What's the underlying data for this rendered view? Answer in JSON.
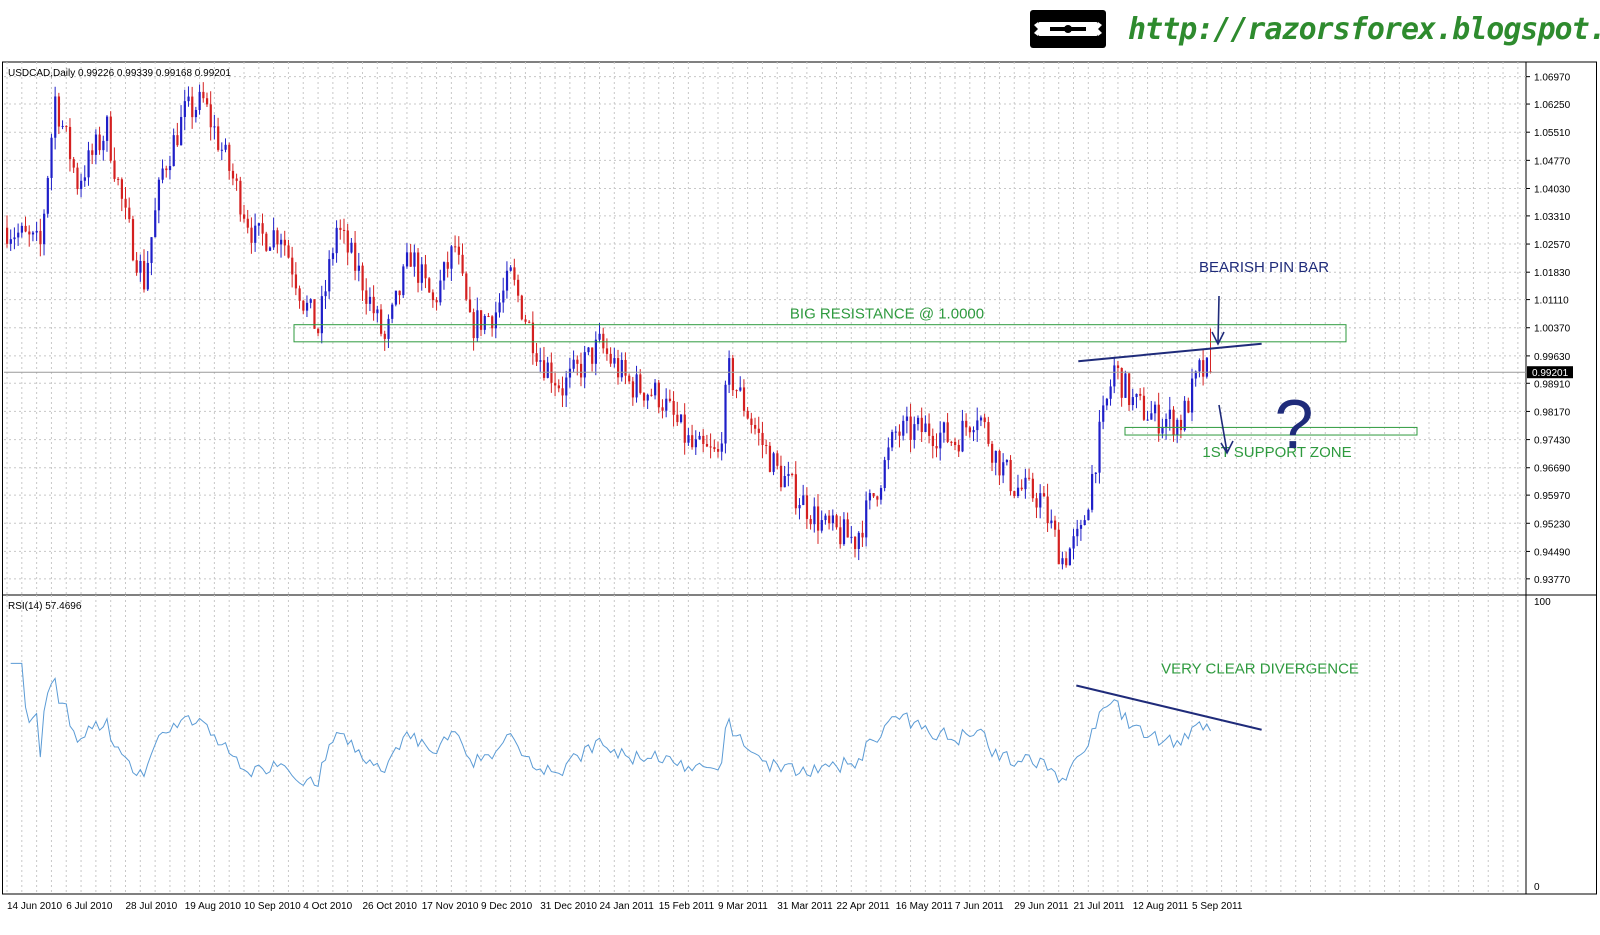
{
  "header": {
    "url": "http://razorsforex.blogspot.com",
    "logo_icon": "razor-blade-icon"
  },
  "colors": {
    "bull_candle": "#1f1fc8",
    "bear_candle": "#d42020",
    "grid": "#c8c8c8",
    "rsi_line": "#5b9bd5",
    "annotation_green": "#2e9a3e",
    "annotation_navy": "#1f2b7a"
  },
  "chart_data": [
    {
      "type": "candlestick",
      "title": "USDCAD,Daily  0.99226 0.99339 0.99168 0.99201",
      "symbol": "USDCAD",
      "timeframe": "Daily",
      "ohlc_last": {
        "open": 0.99226,
        "high": 0.99339,
        "low": 0.99168,
        "close": 0.99201
      },
      "current_price_label": "0.99201",
      "ylim": [
        0.9345,
        1.0725
      ],
      "y_ticks": [
        "1.06970",
        "1.06250",
        "1.05510",
        "1.04770",
        "1.04030",
        "1.03310",
        "1.02570",
        "1.01830",
        "1.01110",
        "1.00370",
        "0.99630",
        "0.98910",
        "0.98170",
        "0.97430",
        "0.96690",
        "0.95970",
        "0.95230",
        "0.94490",
        "0.93770"
      ],
      "x_ticks": [
        "14 Jun 2010",
        "6 Jul 2010",
        "28 Jul 2010",
        "19 Aug 2010",
        "10 Sep 2010",
        "4 Oct 2010",
        "26 Oct 2010",
        "17 Nov 2010",
        "9 Dec 2010",
        "31 Dec 2010",
        "24 Jan 2011",
        "15 Feb 2011",
        "9 Mar 2011",
        "31 Mar 2011",
        "22 Apr 2011",
        "16 May 2011",
        "7 Jun 2011",
        "29 Jun 2011",
        "21 Jul 2011",
        "12 Aug 2011",
        "5 Sep 2011"
      ],
      "close_path": [
        {
          "date": "14 Jun 2010",
          "close": 1.03
        },
        {
          "date": "25 Jun 2010",
          "close": 1.025
        },
        {
          "date": "1 Jul 2010",
          "close": 1.064
        },
        {
          "date": "9 Jul 2010",
          "close": 1.042
        },
        {
          "date": "21 Jul 2010",
          "close": 1.056
        },
        {
          "date": "28 Jul 2010",
          "close": 1.032
        },
        {
          "date": "4 Aug 2010",
          "close": 1.016
        },
        {
          "date": "11 Aug 2010",
          "close": 1.045
        },
        {
          "date": "19 Aug 2010",
          "close": 1.06
        },
        {
          "date": "26 Aug 2010",
          "close": 1.063
        },
        {
          "date": "3 Sep 2010",
          "close": 1.048
        },
        {
          "date": "15 Sep 2010",
          "close": 1.027
        },
        {
          "date": "24 Sep 2010",
          "close": 1.029
        },
        {
          "date": "4 Oct 2010",
          "close": 1.011
        },
        {
          "date": "8 Oct 2010",
          "close": 1.003
        },
        {
          "date": "15 Oct 2010",
          "close": 1.03
        },
        {
          "date": "26 Oct 2010",
          "close": 1.016
        },
        {
          "date": "3 Nov 2010",
          "close": 1.0
        },
        {
          "date": "12 Nov 2010",
          "close": 1.023
        },
        {
          "date": "22 Nov 2010",
          "close": 1.01
        },
        {
          "date": "30 Nov 2010",
          "close": 1.025
        },
        {
          "date": "6 Dec 2010",
          "close": 1.004
        },
        {
          "date": "15 Dec 2010",
          "close": 1.008
        },
        {
          "date": "21 Dec 2010",
          "close": 1.017
        },
        {
          "date": "31 Dec 2010",
          "close": 0.996
        },
        {
          "date": "10 Jan 2011",
          "close": 0.988
        },
        {
          "date": "24 Jan 2011",
          "close": 0.999
        },
        {
          "date": "3 Feb 2011",
          "close": 0.989
        },
        {
          "date": "15 Feb 2011",
          "close": 0.986
        },
        {
          "date": "28 Feb 2011",
          "close": 0.972
        },
        {
          "date": "9 Mar 2011",
          "close": 0.97
        },
        {
          "date": "14 Mar 2011",
          "close": 0.992
        },
        {
          "date": "24 Mar 2011",
          "close": 0.975
        },
        {
          "date": "31 Mar 2011",
          "close": 0.966
        },
        {
          "date": "8 Apr 2011",
          "close": 0.959
        },
        {
          "date": "19 Apr 2011",
          "close": 0.951
        },
        {
          "date": "29 Apr 2011",
          "close": 0.948
        },
        {
          "date": "9 May 2011",
          "close": 0.962
        },
        {
          "date": "16 May 2011",
          "close": 0.976
        },
        {
          "date": "27 May 2011",
          "close": 0.977
        },
        {
          "date": "7 Jun 2011",
          "close": 0.974
        },
        {
          "date": "15 Jun 2011",
          "close": 0.982
        },
        {
          "date": "22 Jun 2011",
          "close": 0.97
        },
        {
          "date": "29 Jun 2011",
          "close": 0.962
        },
        {
          "date": "8 Jul 2011",
          "close": 0.959
        },
        {
          "date": "18 Jul 2011",
          "close": 0.943
        },
        {
          "date": "25 Jul 2011",
          "close": 0.949
        },
        {
          "date": "1 Aug 2011",
          "close": 0.975
        },
        {
          "date": "5 Aug 2011",
          "close": 0.993
        },
        {
          "date": "12 Aug 2011",
          "close": 0.984
        },
        {
          "date": "22 Aug 2011",
          "close": 0.98
        },
        {
          "date": "31 Aug 2011",
          "close": 0.979
        },
        {
          "date": "7 Sep 2011",
          "close": 0.992
        },
        {
          "date": "12 Sep 2011",
          "close": 0.99201
        }
      ],
      "annotations": {
        "resistance_label": "BIG RESISTANCE @ 1.0000",
        "resistance_zone": [
          1.0,
          1.0045
        ],
        "support_label": "1ST SUPPORT ZONE",
        "support_zone": [
          0.9755,
          0.9775
        ],
        "pin_bar_label": "BEARISH PIN BAR",
        "question_mark": "?",
        "trendline": {
          "from": {
            "date": "27 Jul 2011",
            "price": 0.9949
          },
          "to": {
            "date": "15 Sep 2011",
            "price": 0.9995
          }
        }
      }
    },
    {
      "type": "line",
      "title": "RSI(14) 57.4696",
      "indicator": "RSI(14)",
      "current_value": 57.4696,
      "ylim": [
        0,
        100
      ],
      "y_ticks": [
        "100",
        "0"
      ],
      "divergence_label": "VERY CLEAR DIVERGENCE",
      "divergence_line": {
        "from": {
          "date": "27 Jul 2011",
          "rsi": 70
        },
        "to": {
          "date": "15 Sep 2011",
          "rsi": 55
        }
      }
    }
  ]
}
